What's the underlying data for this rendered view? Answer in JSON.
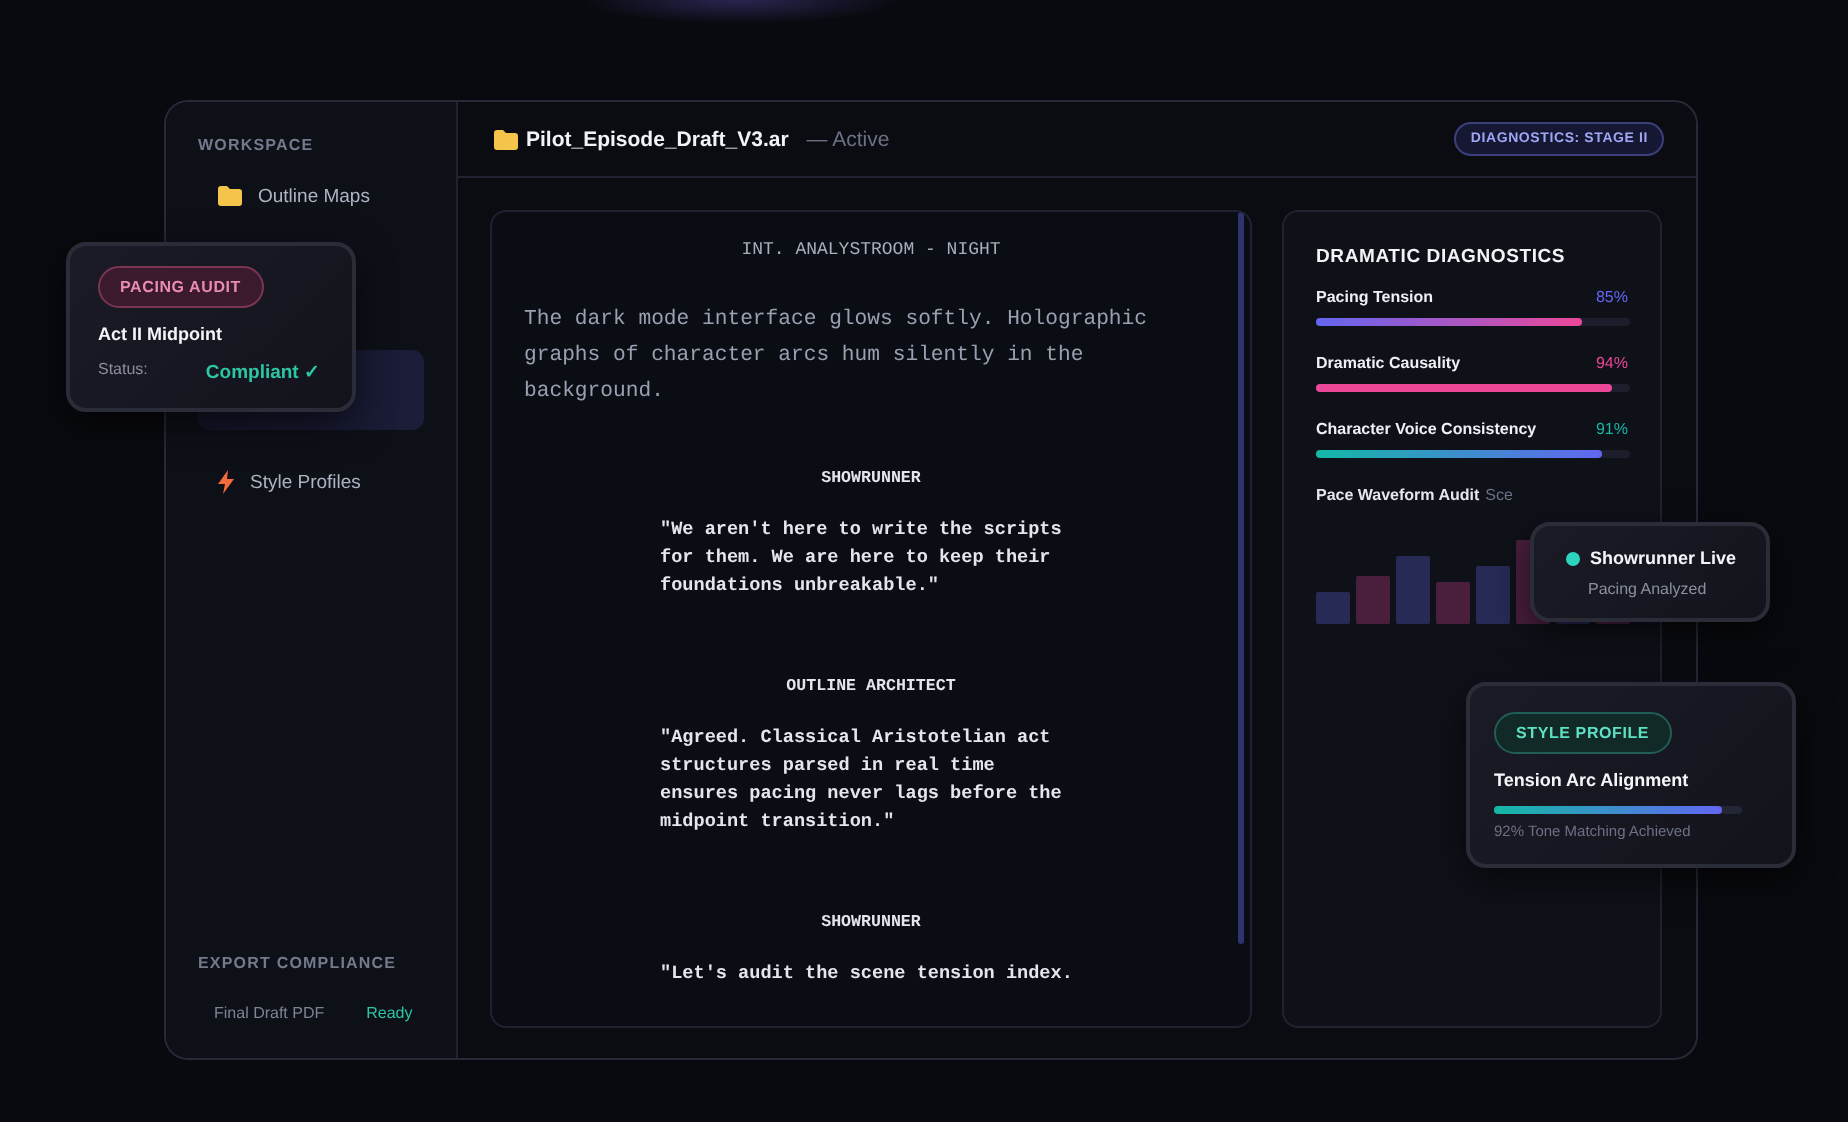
{
  "sidebar": {
    "section_label": "WORKSPACE",
    "items": [
      {
        "label": "Outline Maps",
        "kind": "folder",
        "selected": false
      },
      {
        "label": "Style Profiles",
        "kind": "bolt",
        "selected": false
      }
    ],
    "footer": {
      "label": "EXPORT COMPLIANCE",
      "items": [
        {
          "label": "Final Draft PDF",
          "status": "Ready"
        }
      ]
    }
  },
  "header": {
    "file_name": "Pilot_Episode_Draft_V3.ar",
    "state": "— Active",
    "badge": "DIAGNOSTICS: STAGE II"
  },
  "script": {
    "blocks": [
      {
        "kind": "heading",
        "text": "INT. ANALYSTROOM - NIGHT"
      },
      {
        "kind": "action",
        "text": "The dark mode interface glows softly. Holographic graphs of character arcs hum silently in the background."
      },
      {
        "kind": "character",
        "text": "SHOWRUNNER"
      },
      {
        "kind": "dialogue",
        "text": "\"We aren't here to write the scripts for them. We are here to keep their foundations unbreakable.\""
      },
      {
        "kind": "character",
        "text": "OUTLINE ARCHITECT"
      },
      {
        "kind": "dialogue",
        "text": "\"Agreed. Classical Aristotelian act structures parsed in real time ensures pacing never lags before the midpoint transition.\""
      },
      {
        "kind": "character",
        "text": "SHOWRUNNER"
      },
      {
        "kind": "dialogue",
        "text": "\"Let's audit the scene tension index."
      }
    ]
  },
  "diagnostics": {
    "title": "DRAMATIC DIAGNOSTICS",
    "metrics": [
      {
        "label": "Pacing Tension",
        "value": "85%",
        "level": 0.85,
        "color": "#6366f1",
        "kind": "rising"
      },
      {
        "label": "Dramatic Causality",
        "value": "94%",
        "level": 0.94,
        "color": "#ec4899",
        "kind": "solid"
      },
      {
        "label": "Character Voice Consistency",
        "value": "91%",
        "level": 0.91,
        "color": "#14b8a6",
        "kind": "cool"
      }
    ],
    "waveform": {
      "title": "Pace Waveform Audit",
      "subtitle": "Sce"
    }
  },
  "cards": [
    {
      "kind": "audit",
      "badge": "PACING AUDIT",
      "title": "Act II Midpoint",
      "status_label": "Status:",
      "status": "Compliant ✓"
    },
    {
      "kind": "live",
      "title": "Showrunner Live",
      "subtitle": "Pacing Analyzed"
    },
    {
      "kind": "profile",
      "badge": "STYLE PROFILE",
      "title": "Tension Arc Alignment",
      "level": 0.92,
      "caption": "92% Tone Matching Achieved"
    }
  ]
}
